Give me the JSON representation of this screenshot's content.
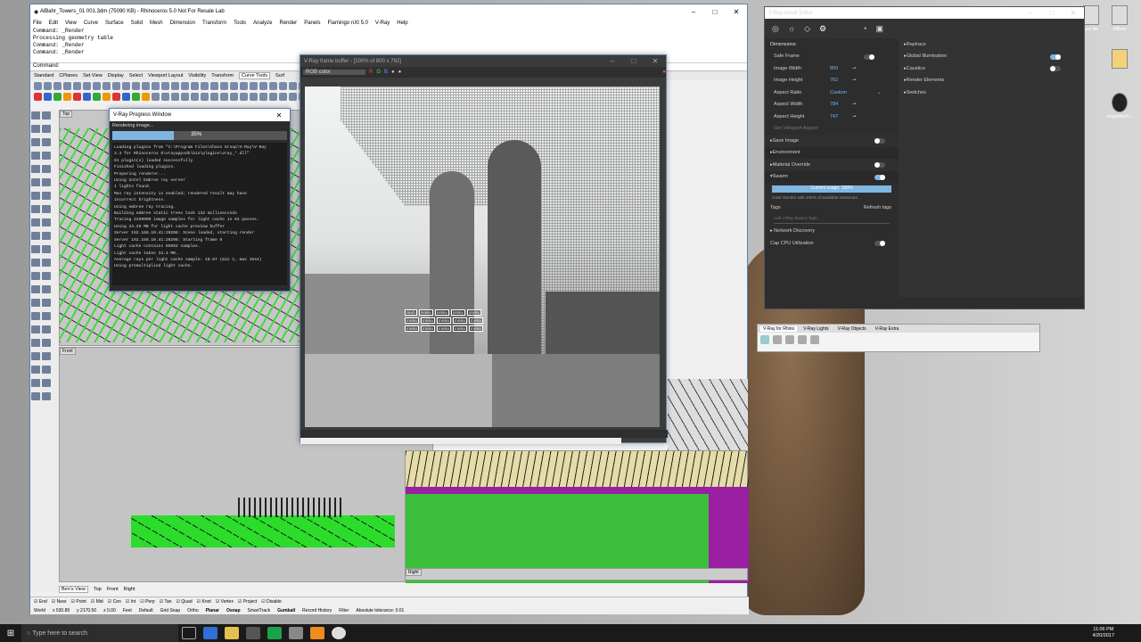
{
  "colors": {
    "accent": "#7fb6e0",
    "geometry": "#2bdc2b",
    "purple": "#9a1fa2",
    "taskbar": "#1a1a1a"
  },
  "rhino": {
    "title": "AlBahr_Towers_01 001.3dm (75090 KB) - Rhinoceros 5.0 Not For Resale Lab",
    "menus": [
      "File",
      "Edit",
      "View",
      "Curve",
      "Surface",
      "Solid",
      "Mesh",
      "Dimension",
      "Transform",
      "Tools",
      "Analyze",
      "Render",
      "Panels",
      "Flamingo nXt 5.0",
      "V-Ray",
      "Help"
    ],
    "history": [
      "Command: _Render",
      "Processing geometry table",
      "Command: _Render",
      "Command: _Render"
    ],
    "command_label": "Command:",
    "toolbar_tabs": [
      "Standard",
      "CPlanes",
      "Set View",
      "Display",
      "Select",
      "Viewport Layout",
      "Visibility",
      "Transform",
      "Curve Tools",
      "Surf"
    ],
    "viewports": {
      "top": "Top",
      "front": "Front",
      "right": "Right"
    },
    "view_tabs": [
      "Ben's View",
      "Top",
      "Front",
      "Right"
    ],
    "osnaps": [
      "End",
      "Near",
      "Point",
      "Mid",
      "Cen",
      "Int",
      "Perp",
      "Tan",
      "Quad",
      "Knot",
      "Vertex",
      "Project",
      "Disable"
    ],
    "status": {
      "cplane": "World",
      "x": "x 530.89",
      "y": "y 2170.50",
      "z": "z 0.00",
      "units": "Feet",
      "layer": "Default",
      "items": [
        "Grid Snap",
        "Ortho",
        "Planar",
        "Osnap",
        "SmartTrack",
        "Gumball",
        "Record History",
        "Filter"
      ],
      "tolerance": "Absolute tolerance: 0.01"
    }
  },
  "progress": {
    "title": "V-Ray Progress Window",
    "state": "Rendering image...",
    "percent_label": "35%",
    "percent": 0.35,
    "log": [
      "Loading plugins from \"C:\\Program Files\\Chaos Group\\V-Ray\\V-Ray",
      "3.4 for Rhinoceros 5\\vrayappsdk\\bin\\plugins\\vray_*.dll\"",
      "81 plugin(s) loaded successfully",
      "Finished loading plugins.",
      "Preparing renderer...",
      "Using Intel Embree ray server",
      "1 lights found.",
      "Max ray intensity is enabled; rendered result may have",
      "incorrect brightness.",
      "Using embree ray tracing.",
      "Building embree static trees took 133 milliseconds",
      "Tracing 2250000 image samples for light cache in 64 passes.",
      "Using 23.25 MB for light cache preview buffer",
      "Server 192.168.10.41:20208: Scene loaded, starting render",
      "Server 192.168.10.41:20208: Starting frame 0",
      "Light cache contains 85993 samples.",
      "Light cache takes 34.3 MB.",
      "Average rays per light cache sample: 10.67 (min 1, max 1544)",
      "Using premultiplied light cache."
    ]
  },
  "vfb": {
    "title": "V-Ray frame buffer - [100% of 800 x 762]",
    "channel": "RGB color",
    "buckets": [
      "nkub",
      "mmkx",
      "mmkx",
      "mmkx",
      "mmkx",
      "mmkx",
      "mmkx",
      "mmkx",
      "mmkx",
      "mmkx",
      "mmkx",
      "mmkx",
      "mmkx",
      "mmkx",
      "mmkx"
    ]
  },
  "asset_editor": {
    "title": "V-Ray Asset Editor",
    "section": "Dimensions",
    "rows": [
      {
        "label": "Safe Frame",
        "value": ""
      },
      {
        "label": "Image Width",
        "value": "800"
      },
      {
        "label": "Image Height",
        "value": "762"
      },
      {
        "label": "Aspect Ratio",
        "value": "Custom"
      },
      {
        "label": "Aspect Width",
        "value": "784"
      },
      {
        "label": "Aspect Height",
        "value": "747"
      },
      {
        "label": "Get Viewport Aspect",
        "value": ""
      }
    ],
    "groups": [
      "Save Image",
      "Environment",
      "Material Override",
      "Swarm"
    ],
    "swarm_usage": "Current usage: 100%",
    "swarm_goal": "Goal: Render with 100% of available resources",
    "tags_label": "Tags",
    "refresh_tags": "Refresh tags",
    "tags_placeholder": "Add V-Ray Swarm Tags...",
    "network_discovery": "Network Discovery",
    "cap_cpu": "Cap CPU Utilization",
    "right_items": [
      "Raytrace",
      "Global Illumination",
      "Caustics",
      "Render Elements",
      "Switches"
    ]
  },
  "vray_toolbar": {
    "tabs": [
      "V-Ray for Rhino",
      "V-Ray Lights",
      "V-Ray Objects",
      "V-Ray Extra"
    ]
  },
  "desktop_icons": [
    {
      "label": "ssd file"
    },
    {
      "label": "AlBahr"
    },
    {
      "label": ""
    },
    {
      "label": "magnetech..."
    }
  ],
  "taskbar": {
    "search": "Type here to search",
    "time": "11:06 PM",
    "date": "4/20/2017"
  }
}
